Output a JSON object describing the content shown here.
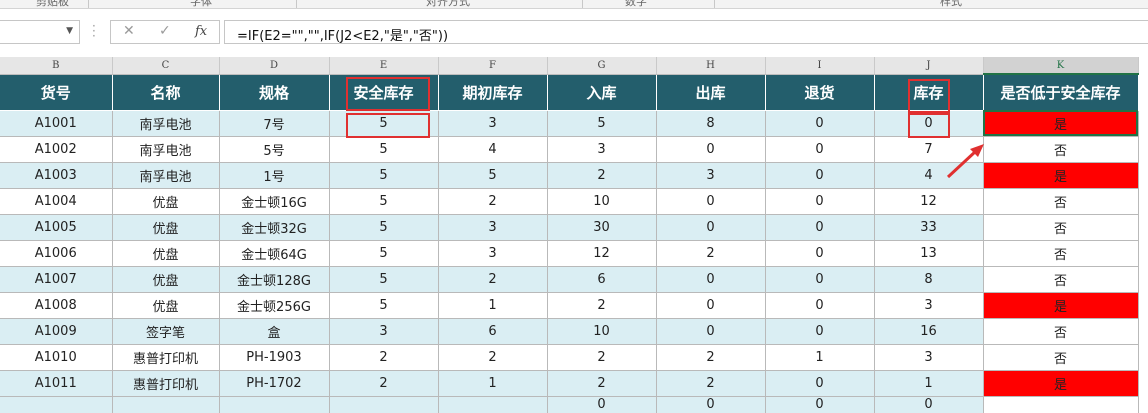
{
  "ribbon": {
    "groups": [
      "剪贴板",
      "字体",
      "对齐方式",
      "数字",
      "样式"
    ]
  },
  "formula_bar": {
    "name_box": "",
    "cancel_icon": "✕",
    "enter_icon": "✓",
    "fx_label": "fx",
    "formula": "=IF(E2=\"\",\"\",IF(J2<E2,\"是\",\"否\"))"
  },
  "sheet": {
    "column_letters": [
      "B",
      "C",
      "D",
      "E",
      "F",
      "G",
      "H",
      "I",
      "J",
      "K"
    ],
    "headers": [
      "货号",
      "名称",
      "规格",
      "安全库存",
      "期初库存",
      "入库",
      "出库",
      "退货",
      "库存",
      "是否低于安全库存"
    ],
    "rows": [
      [
        "A1001",
        "南孚电池",
        "7号",
        "5",
        "3",
        "5",
        "8",
        "0",
        "0",
        "是"
      ],
      [
        "A1002",
        "南孚电池",
        "5号",
        "5",
        "4",
        "3",
        "0",
        "0",
        "7",
        "否"
      ],
      [
        "A1003",
        "南孚电池",
        "1号",
        "5",
        "5",
        "2",
        "3",
        "0",
        "4",
        "是"
      ],
      [
        "A1004",
        "优盘",
        "金士顿16G",
        "5",
        "2",
        "10",
        "0",
        "0",
        "12",
        "否"
      ],
      [
        "A1005",
        "优盘",
        "金士顿32G",
        "5",
        "3",
        "30",
        "0",
        "0",
        "33",
        "否"
      ],
      [
        "A1006",
        "优盘",
        "金士顿64G",
        "5",
        "3",
        "12",
        "2",
        "0",
        "13",
        "否"
      ],
      [
        "A1007",
        "优盘",
        "金士顿128G",
        "5",
        "2",
        "6",
        "0",
        "0",
        "8",
        "否"
      ],
      [
        "A1008",
        "优盘",
        "金士顿256G",
        "5",
        "1",
        "2",
        "0",
        "0",
        "3",
        "是"
      ],
      [
        "A1009",
        "签字笔",
        "盒",
        "3",
        "6",
        "10",
        "0",
        "0",
        "16",
        "否"
      ],
      [
        "A1010",
        "惠普打印机",
        "PH-1903",
        "2",
        "2",
        "2",
        "2",
        "1",
        "3",
        "否"
      ],
      [
        "A1011",
        "惠普打印机",
        "PH-1702",
        "2",
        "1",
        "2",
        "2",
        "0",
        "1",
        "是"
      ]
    ],
    "last_row": [
      "",
      "",
      "",
      "",
      "",
      "0",
      "0",
      "0",
      "0",
      ""
    ],
    "colors": {
      "header_bg": "#235e6c",
      "shade": "#daeef3",
      "flag_red": "#ff0000",
      "annotation": "#e03030"
    }
  }
}
